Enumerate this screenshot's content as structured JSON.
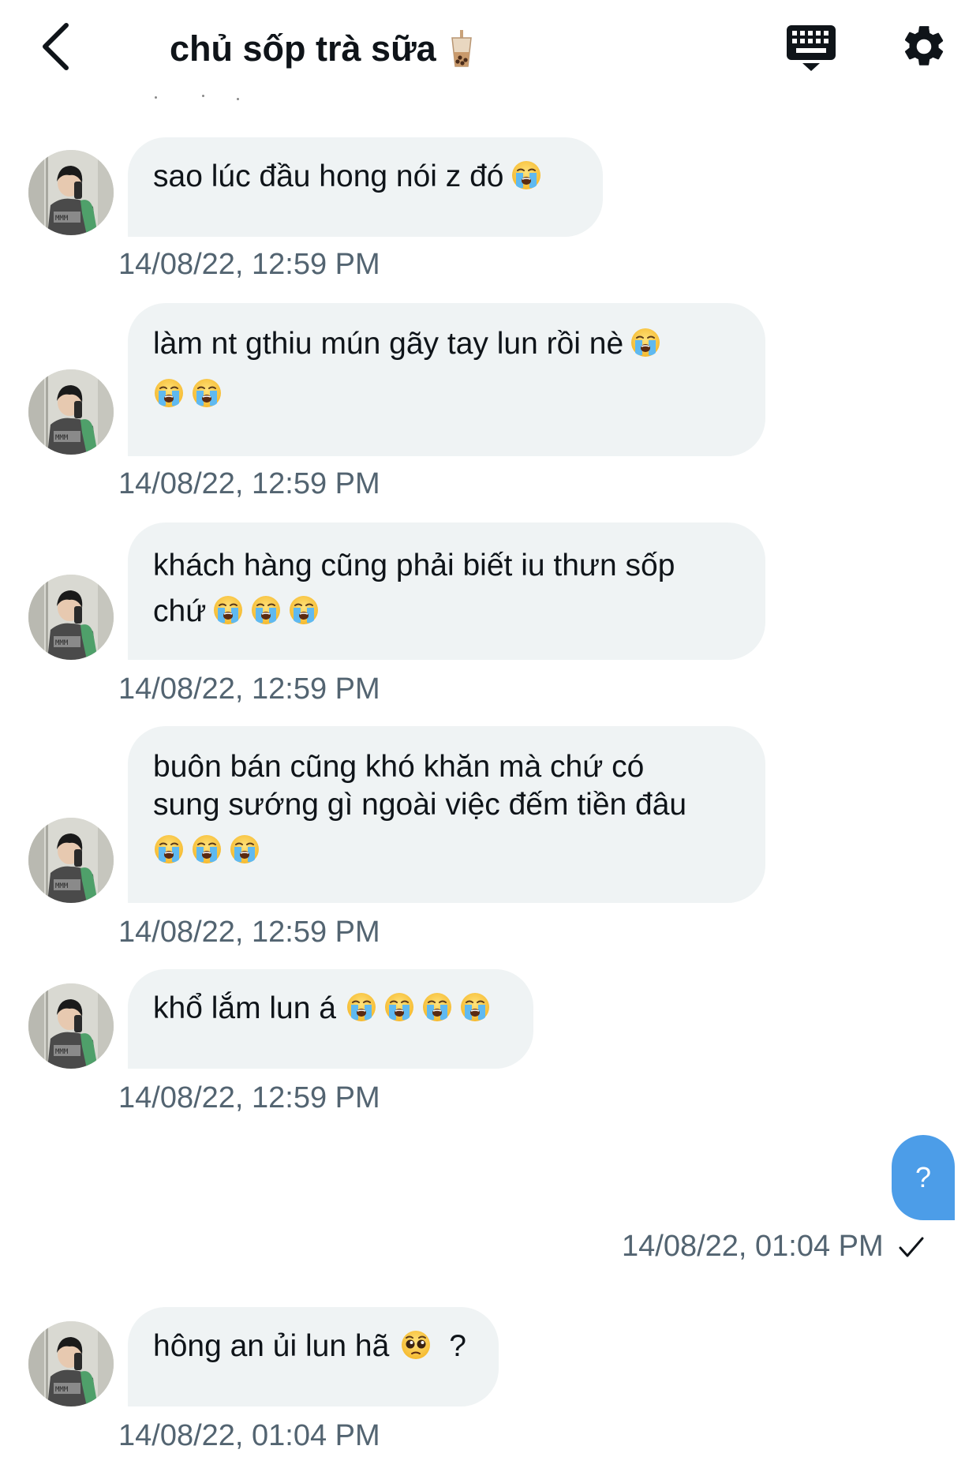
{
  "header": {
    "back_icon": "chevron-left-icon",
    "title": "chủ sốp trà sữa",
    "title_icon": "bubble-tea-icon",
    "keyboard_icon": "keyboard-icon",
    "settings_icon": "gear-icon"
  },
  "messages": [
    {
      "text_lines": [
        "sao lúc đầu hong nói z đó"
      ],
      "emoji_count": 1,
      "timestamp": "14/08/22, 12:59 PM"
    },
    {
      "text_lines": [
        "làm nt gthiu mún gãy tay lun rồi nè"
      ],
      "emoji_count": 3,
      "timestamp": "14/08/22, 12:59 PM"
    },
    {
      "text_lines": [
        "khách hàng cũng phải biết iu thưn sốp",
        "chứ"
      ],
      "emoji_count": 3,
      "timestamp": "14/08/22, 12:59 PM"
    },
    {
      "text_lines": [
        "buôn bán cũng khó khăn mà chứ có",
        "sung sướng gì ngoài việc đếm tiền đâu"
      ],
      "emoji_count": 3,
      "timestamp": "14/08/22, 12:59 PM"
    },
    {
      "text_lines": [
        "khổ lắm lun á"
      ],
      "emoji_count": 4,
      "timestamp": "14/08/22, 12:59 PM"
    },
    {
      "text_lines": [
        "hông an ủi lun hã"
      ],
      "suffix": "?",
      "emoji": "pleading-face",
      "timestamp": "14/08/22, 01:04 PM"
    }
  ],
  "sent": {
    "text": "?",
    "timestamp": "14/08/22, 01:04 PM",
    "status_icon": "checkmark-icon"
  },
  "colors": {
    "received_bubble": "#eff3f4",
    "sent_bubble": "#4c9de8",
    "timestamp": "#536471"
  }
}
